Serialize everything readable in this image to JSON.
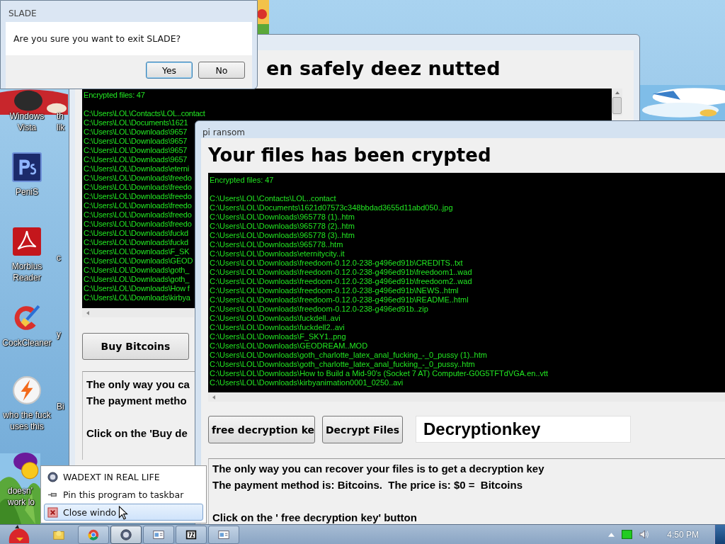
{
  "dialog": {
    "title": "SLADE",
    "message": "Are you sure you want to exit SLADE?",
    "buttons": [
      {
        "label": "Yes",
        "focused": true
      },
      {
        "label": "No",
        "focused": false
      }
    ]
  },
  "desktop_icons": [
    {
      "kind": "hidden",
      "label_lines": [
        "Windows",
        "Vista"
      ]
    },
    {
      "kind": "ps",
      "label_lines": [
        "PeniS"
      ]
    },
    {
      "kind": "pdf",
      "label_lines": [
        "Morbius",
        "Reader"
      ]
    },
    {
      "kind": "cleaner",
      "label_lines": [
        "CockCleaner"
      ]
    },
    {
      "kind": "bolt",
      "label_lines": [
        "who the fuck",
        "uses this"
      ]
    },
    {
      "kind": "yahoo",
      "label_lines": [
        "doesn'",
        "work lo"
      ]
    }
  ],
  "partial_icon_labels": [
    {
      "label_lines": [
        "th",
        "lik"
      ]
    },
    {
      "label_lines": [
        "c"
      ]
    },
    {
      "label_lines": [
        "y"
      ]
    },
    {
      "label_lines": [
        "Bi"
      ]
    }
  ],
  "back_window": {
    "heading": "en safely deez nutted",
    "log": {
      "header": "Encrypted files: 47",
      "lines": [
        "C:\\Users\\LOL\\Contacts\\LOL..contact",
        "C:\\Users\\LOL\\Documents\\1621",
        "C:\\Users\\LOL\\Downloads\\9657",
        "C:\\Users\\LOL\\Downloads\\9657",
        "C:\\Users\\LOL\\Downloads\\9657",
        "C:\\Users\\LOL\\Downloads\\9657",
        "C:\\Users\\LOL\\Downloads\\eterni",
        "C:\\Users\\LOL\\Downloads\\freedo",
        "C:\\Users\\LOL\\Downloads\\freedo",
        "C:\\Users\\LOL\\Downloads\\freedo",
        "C:\\Users\\LOL\\Downloads\\freedo",
        "C:\\Users\\LOL\\Downloads\\freedo",
        "C:\\Users\\LOL\\Downloads\\freedo",
        "C:\\Users\\LOL\\Downloads\\fuckd",
        "C:\\Users\\LOL\\Downloads\\fuckd",
        "C:\\Users\\LOL\\Downloads\\F_SK",
        "C:\\Users\\LOL\\Downloads\\GEOD",
        "C:\\Users\\LOL\\Downloads\\goth_",
        "C:\\Users\\LOL\\Downloads\\goth_",
        "C:\\Users\\LOL\\Downloads\\How f",
        "C:\\Users\\LOL\\Downloads\\kirbya"
      ]
    },
    "button": "Buy Bitcoins",
    "info": {
      "lines": [
        "The only way you ca",
        "The payment metho"
      ],
      "instruction": "Click on the 'Buy de"
    }
  },
  "front_window": {
    "title": "pi ransom",
    "heading": "Your files has been crypted",
    "log": {
      "header": "Encrypted files: 47",
      "lines": [
        "C:\\Users\\LOL\\Contacts\\LOL..contact",
        "C:\\Users\\LOL\\Documents\\1621d07573c348bbdad3655d11abd050..jpg",
        "C:\\Users\\LOL\\Downloads\\965778 (1)..htm",
        "C:\\Users\\LOL\\Downloads\\965778 (2)..htm",
        "C:\\Users\\LOL\\Downloads\\965778 (3)..htm",
        "C:\\Users\\LOL\\Downloads\\965778..htm",
        "C:\\Users\\LOL\\Downloads\\eternitycity..it",
        "C:\\Users\\LOL\\Downloads\\freedoom-0.12.0-238-g496ed91b\\CREDITS..txt",
        "C:\\Users\\LOL\\Downloads\\freedoom-0.12.0-238-g496ed91b\\freedoom1..wad",
        "C:\\Users\\LOL\\Downloads\\freedoom-0.12.0-238-g496ed91b\\freedoom2..wad",
        "C:\\Users\\LOL\\Downloads\\freedoom-0.12.0-238-g496ed91b\\NEWS..html",
        "C:\\Users\\LOL\\Downloads\\freedoom-0.12.0-238-g496ed91b\\README..html",
        "C:\\Users\\LOL\\Downloads\\freedoom-0.12.0-238-g496ed91b..zip",
        "C:\\Users\\LOL\\Downloads\\fuckdell..avi",
        "C:\\Users\\LOL\\Downloads\\fuckdell2..avi",
        "C:\\Users\\LOL\\Downloads\\F_SKY1..png",
        "C:\\Users\\LOL\\Downloads\\GEODREAM..MOD",
        "C:\\Users\\LOL\\Downloads\\goth_charlotte_latex_anal_fucking_-_0_pussy (1)..htm",
        "C:\\Users\\LOL\\Downloads\\goth_charlotte_latex_anal_fucking_-_0_pussy..htm",
        "C:\\Users\\LOL\\Downloads\\How to Build a Mid-90's (Socket 7 AT) Computer-G0G5TFTdVGA.en..vtt",
        "C:\\Users\\LOL\\Downloads\\kirbyanimation0001_0250..avi"
      ]
    },
    "buttons": [
      "free decryption ke",
      "Decrypt Files"
    ],
    "key_field": {
      "value": "Decryptionkey"
    },
    "info": {
      "lines": [
        "The only way you can recover your files is to get a decryption key",
        "The payment method is: Bitcoins.  The price is: $0 =  Bitcoins"
      ],
      "instruction": "Click on the ' free decryption key' button"
    }
  },
  "jump_list": {
    "items": [
      {
        "kind": "app",
        "label": "WADEXT IN REAL LIFE",
        "highlighted": false
      },
      {
        "kind": "pin",
        "label": "Pin this program to taskbar",
        "highlighted": false
      },
      {
        "kind": "close",
        "label": "Close windo",
        "highlighted": true
      }
    ]
  },
  "taskbar": {
    "buttons": [
      {
        "kind": "folder",
        "active": false
      },
      {
        "kind": "browser",
        "active": false
      },
      {
        "kind": "app",
        "active": true
      },
      {
        "kind": "window",
        "active": false
      },
      {
        "kind": "archive",
        "active": false
      },
      {
        "kind": "window",
        "active": false
      }
    ],
    "clock": "4:50 PM"
  }
}
